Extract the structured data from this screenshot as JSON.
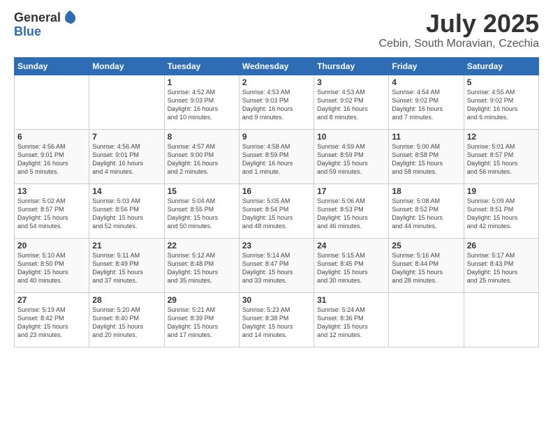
{
  "logo": {
    "general": "General",
    "blue": "Blue"
  },
  "title": "July 2025",
  "subtitle": "Cebin, South Moravian, Czechia",
  "headers": [
    "Sunday",
    "Monday",
    "Tuesday",
    "Wednesday",
    "Thursday",
    "Friday",
    "Saturday"
  ],
  "weeks": [
    [
      {
        "day": "",
        "info": ""
      },
      {
        "day": "",
        "info": ""
      },
      {
        "day": "1",
        "info": "Sunrise: 4:52 AM\nSunset: 9:03 PM\nDaylight: 16 hours\nand 10 minutes."
      },
      {
        "day": "2",
        "info": "Sunrise: 4:53 AM\nSunset: 9:03 PM\nDaylight: 16 hours\nand 9 minutes."
      },
      {
        "day": "3",
        "info": "Sunrise: 4:53 AM\nSunset: 9:02 PM\nDaylight: 16 hours\nand 8 minutes."
      },
      {
        "day": "4",
        "info": "Sunrise: 4:54 AM\nSunset: 9:02 PM\nDaylight: 16 hours\nand 7 minutes."
      },
      {
        "day": "5",
        "info": "Sunrise: 4:55 AM\nSunset: 9:02 PM\nDaylight: 16 hours\nand 6 minutes."
      }
    ],
    [
      {
        "day": "6",
        "info": "Sunrise: 4:56 AM\nSunset: 9:01 PM\nDaylight: 16 hours\nand 5 minutes."
      },
      {
        "day": "7",
        "info": "Sunrise: 4:56 AM\nSunset: 9:01 PM\nDaylight: 16 hours\nand 4 minutes."
      },
      {
        "day": "8",
        "info": "Sunrise: 4:57 AM\nSunset: 9:00 PM\nDaylight: 16 hours\nand 2 minutes."
      },
      {
        "day": "9",
        "info": "Sunrise: 4:58 AM\nSunset: 8:59 PM\nDaylight: 16 hours\nand 1 minute."
      },
      {
        "day": "10",
        "info": "Sunrise: 4:59 AM\nSunset: 8:59 PM\nDaylight: 15 hours\nand 59 minutes."
      },
      {
        "day": "11",
        "info": "Sunrise: 5:00 AM\nSunset: 8:58 PM\nDaylight: 15 hours\nand 58 minutes."
      },
      {
        "day": "12",
        "info": "Sunrise: 5:01 AM\nSunset: 8:57 PM\nDaylight: 15 hours\nand 56 minutes."
      }
    ],
    [
      {
        "day": "13",
        "info": "Sunrise: 5:02 AM\nSunset: 8:57 PM\nDaylight: 15 hours\nand 54 minutes."
      },
      {
        "day": "14",
        "info": "Sunrise: 5:03 AM\nSunset: 8:56 PM\nDaylight: 15 hours\nand 52 minutes."
      },
      {
        "day": "15",
        "info": "Sunrise: 5:04 AM\nSunset: 8:55 PM\nDaylight: 15 hours\nand 50 minutes."
      },
      {
        "day": "16",
        "info": "Sunrise: 5:05 AM\nSunset: 8:54 PM\nDaylight: 15 hours\nand 48 minutes."
      },
      {
        "day": "17",
        "info": "Sunrise: 5:06 AM\nSunset: 8:53 PM\nDaylight: 15 hours\nand 46 minutes."
      },
      {
        "day": "18",
        "info": "Sunrise: 5:08 AM\nSunset: 8:52 PM\nDaylight: 15 hours\nand 44 minutes."
      },
      {
        "day": "19",
        "info": "Sunrise: 5:09 AM\nSunset: 8:51 PM\nDaylight: 15 hours\nand 42 minutes."
      }
    ],
    [
      {
        "day": "20",
        "info": "Sunrise: 5:10 AM\nSunset: 8:50 PM\nDaylight: 15 hours\nand 40 minutes."
      },
      {
        "day": "21",
        "info": "Sunrise: 5:11 AM\nSunset: 8:49 PM\nDaylight: 15 hours\nand 37 minutes."
      },
      {
        "day": "22",
        "info": "Sunrise: 5:12 AM\nSunset: 8:48 PM\nDaylight: 15 hours\nand 35 minutes."
      },
      {
        "day": "23",
        "info": "Sunrise: 5:14 AM\nSunset: 8:47 PM\nDaylight: 15 hours\nand 33 minutes."
      },
      {
        "day": "24",
        "info": "Sunrise: 5:15 AM\nSunset: 8:45 PM\nDaylight: 15 hours\nand 30 minutes."
      },
      {
        "day": "25",
        "info": "Sunrise: 5:16 AM\nSunset: 8:44 PM\nDaylight: 15 hours\nand 28 minutes."
      },
      {
        "day": "26",
        "info": "Sunrise: 5:17 AM\nSunset: 8:43 PM\nDaylight: 15 hours\nand 25 minutes."
      }
    ],
    [
      {
        "day": "27",
        "info": "Sunrise: 5:19 AM\nSunset: 8:42 PM\nDaylight: 15 hours\nand 23 minutes."
      },
      {
        "day": "28",
        "info": "Sunrise: 5:20 AM\nSunset: 8:40 PM\nDaylight: 15 hours\nand 20 minutes."
      },
      {
        "day": "29",
        "info": "Sunrise: 5:21 AM\nSunset: 8:39 PM\nDaylight: 15 hours\nand 17 minutes."
      },
      {
        "day": "30",
        "info": "Sunrise: 5:23 AM\nSunset: 8:38 PM\nDaylight: 15 hours\nand 14 minutes."
      },
      {
        "day": "31",
        "info": "Sunrise: 5:24 AM\nSunset: 8:36 PM\nDaylight: 15 hours\nand 12 minutes."
      },
      {
        "day": "",
        "info": ""
      },
      {
        "day": "",
        "info": ""
      }
    ]
  ]
}
